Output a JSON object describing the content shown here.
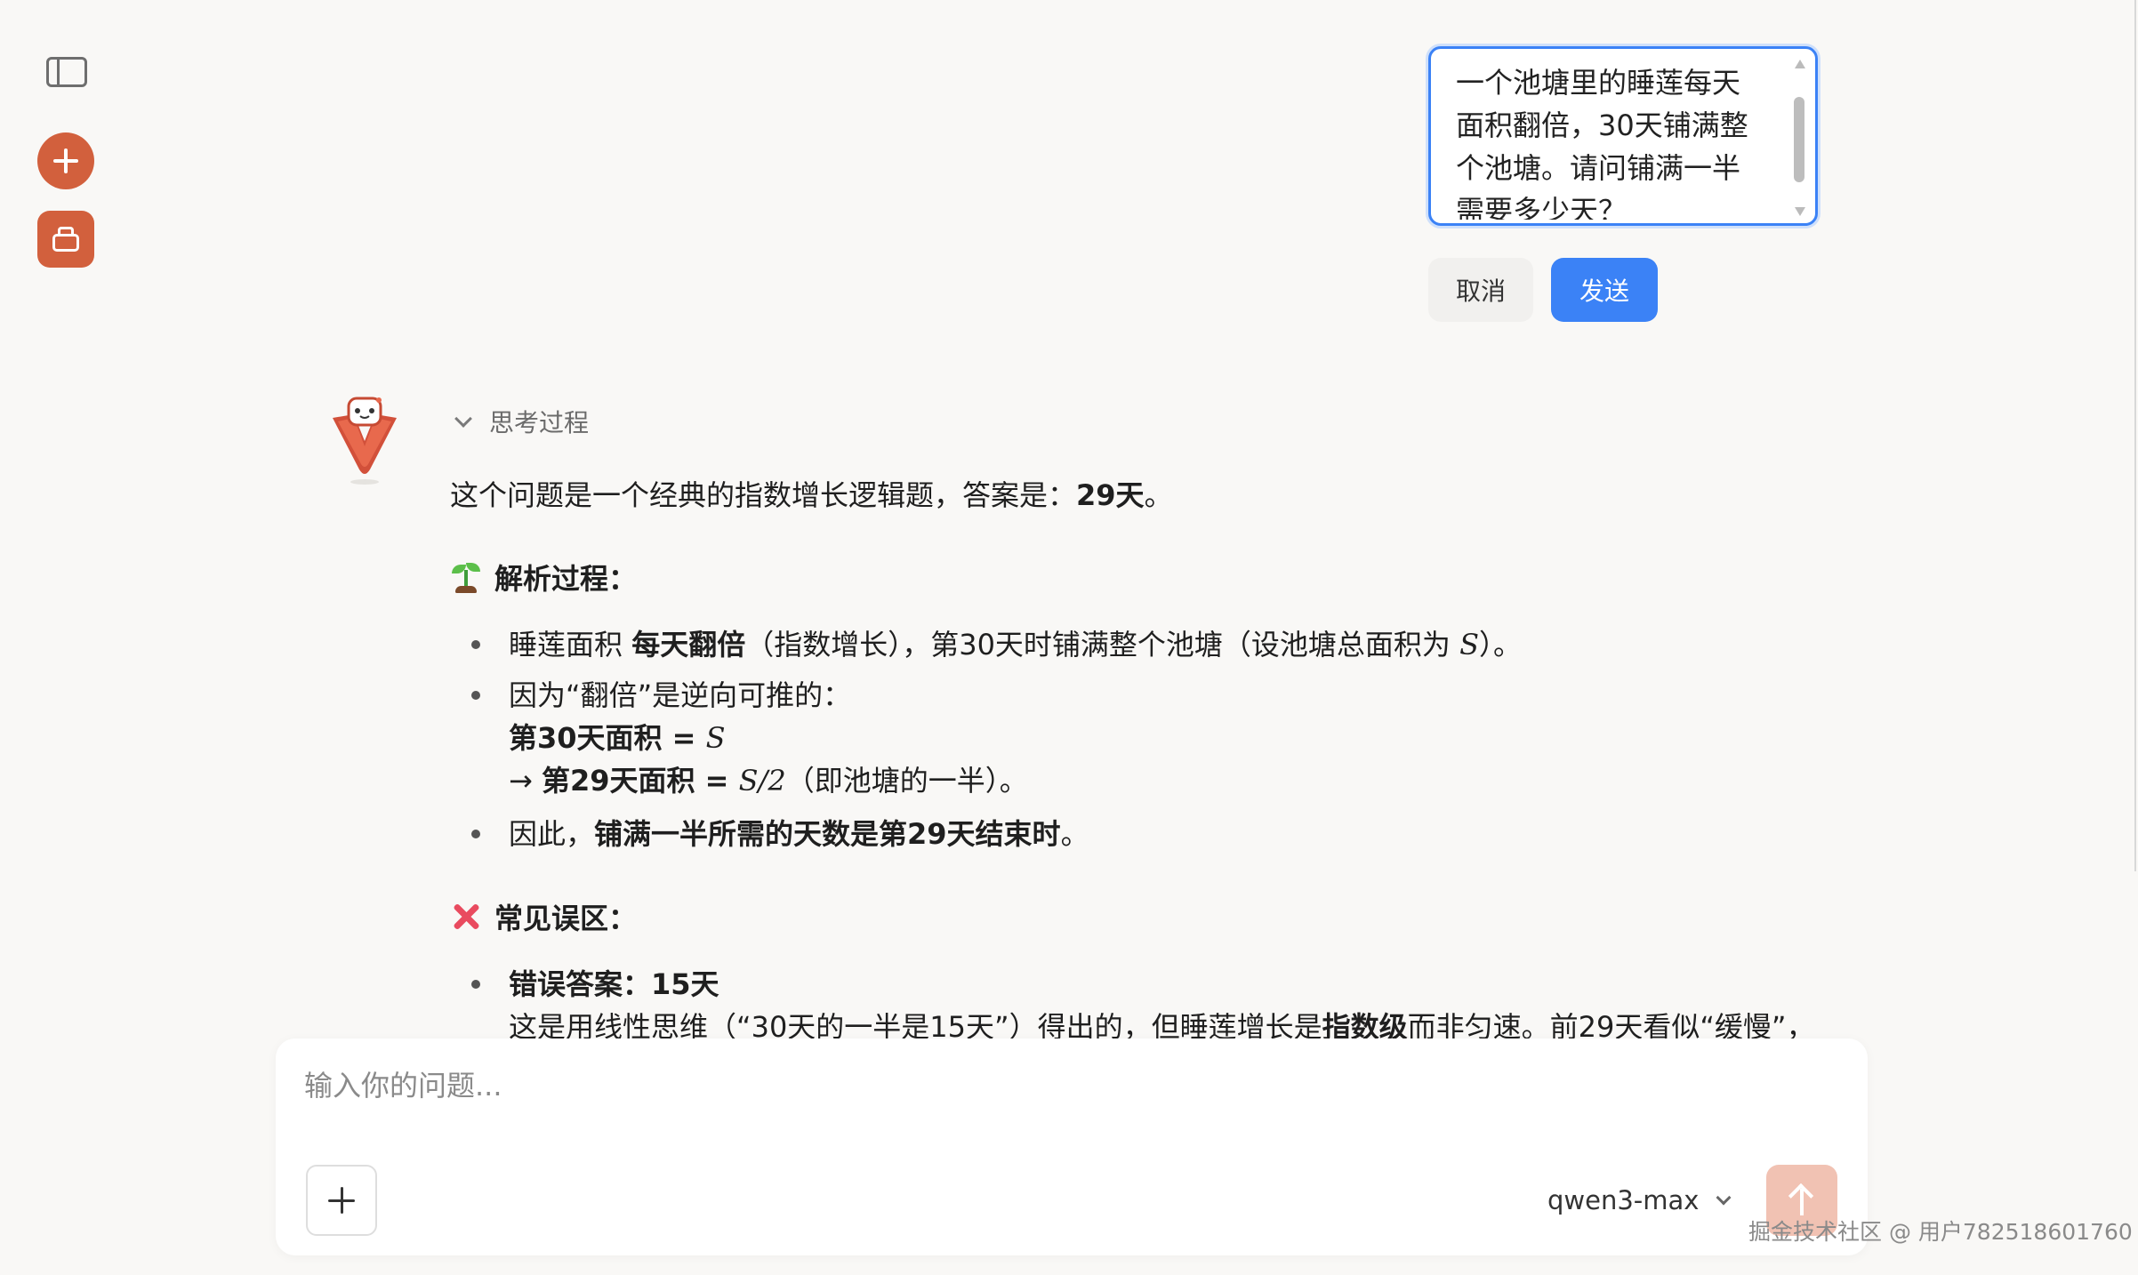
{
  "edit": {
    "text": "一个池塘里的睡莲每天\n面积翻倍，30天铺满整\n个池塘。请问铺满一半\n需要多少天？",
    "cancel_label": "取消",
    "send_label": "发送"
  },
  "thinking_label": "思考过程",
  "answer": {
    "intro_a": "这个问题是一个经典的指数增长逻辑题，答案是：",
    "intro_b": "29天",
    "intro_c": "。",
    "section1_title": "解析过程：",
    "b1_a": "睡莲面积 ",
    "b1_b": "每天翻倍",
    "b1_c": "（指数增长），第30天时铺满整个池塘（设池塘总面积为 ",
    "b1_math": "S",
    "b1_d": "）。",
    "b2_line1": "因为“翻倍”是逆向可推的：",
    "b2_line2_a": "第30天面积 = ",
    "b2_line2_math": "S",
    "b2_line3_a": "→ ",
    "b2_line3_b": "第29天面积 = ",
    "b2_line3_math": "S/2",
    "b2_line3_c": "（即池塘的一半）。",
    "b3_a": "因此，",
    "b3_b": "铺满一半所需的天数是第29天结束时",
    "b3_c": "。",
    "section2_title": "常见误区：",
    "m1_title": "错误答案：15天",
    "m1_a": "这是用线性思维（“30天的一半是15天”）得出的，但睡莲增长是",
    "m1_b": "指数级",
    "m1_c": "而非匀速。前29天看似“缓慢”，"
  },
  "composer": {
    "placeholder": "输入你的问题...",
    "model": "qwen3-max"
  },
  "watermark": "掘金技术社区 @ 用户782518601760",
  "colors": {
    "accent": "#d2603d",
    "primary": "#3b82f6",
    "send_disabled": "#f1c2b3"
  }
}
